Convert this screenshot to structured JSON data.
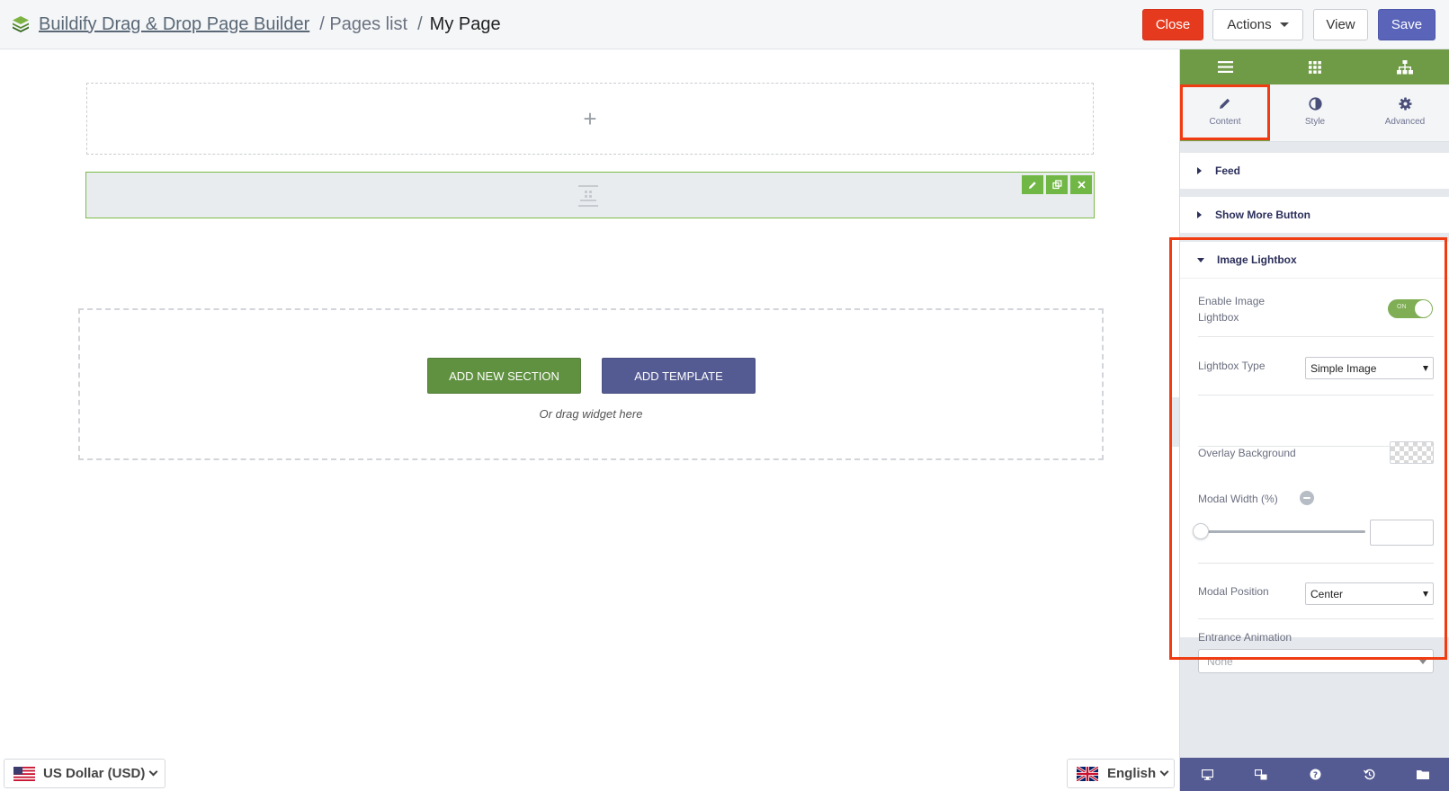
{
  "header": {
    "app_name": "Buildify Drag & Drop Page Builder",
    "crumb_pages": "/ Pages list",
    "crumb_sep": "/",
    "crumb_current": "My Page",
    "close_label": "Close",
    "actions_label": "Actions",
    "view_label": "View",
    "save_label": "Save"
  },
  "canvas": {
    "add_section_label": "ADD NEW SECTION",
    "add_template_label": "ADD TEMPLATE",
    "drag_hint": "Or drag widget here",
    "plus": "+"
  },
  "footer": {
    "currency": "US Dollar (USD)",
    "language": "English"
  },
  "panel": {
    "tabs": [
      {
        "label": "Content",
        "icon": "pencil-icon"
      },
      {
        "label": "Style",
        "icon": "contrast-icon"
      },
      {
        "label": "Advanced",
        "icon": "gear-icon"
      }
    ],
    "sections": {
      "feed": "Feed",
      "show_more": "Show More Button",
      "lightbox": "Image Lightbox"
    },
    "fields": {
      "enable_label_line1": "Enable Image",
      "enable_label_line2": "Lightbox",
      "toggle_text": "ON",
      "lightbox_type_label": "Lightbox Type",
      "lightbox_type_value": "Simple Image",
      "overlay_label": "Overlay Background",
      "modal_width_label": "Modal Width (%)",
      "modal_position_label": "Modal Position",
      "modal_position_value": "Center",
      "entrance_label": "Entrance Animation",
      "entrance_value": "None"
    }
  },
  "colors": {
    "panel_green": "#6f9b47",
    "panel_footer": "#545a92",
    "close_red": "#e63a1e",
    "save_blue": "#5a64b9",
    "highlight": "#f03c12"
  }
}
